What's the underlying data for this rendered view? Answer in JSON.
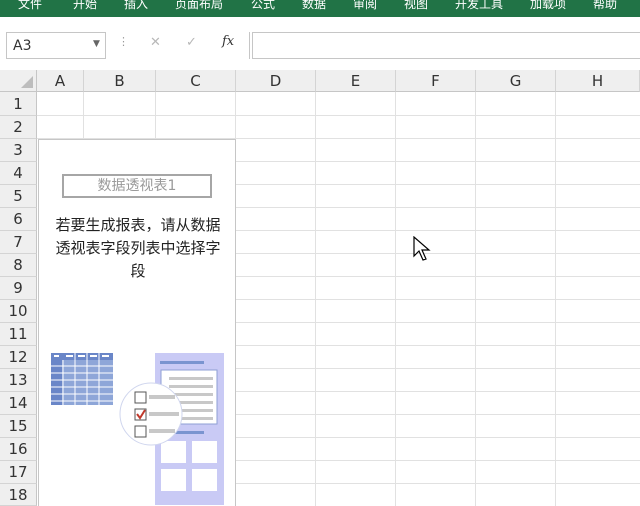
{
  "ribbon": {
    "tabs": [
      "文件",
      "开始",
      "插入",
      "页面布局",
      "公式",
      "数据",
      "审阅",
      "视图",
      "开发工具",
      "加载项",
      "帮助"
    ],
    "color": "#217346"
  },
  "formula_bar": {
    "name_box": "A3",
    "cancel_icon": "✕",
    "enter_icon": "✓",
    "fx_label": "fx",
    "formula_value": ""
  },
  "grid": {
    "columns": [
      "A",
      "B",
      "C",
      "D",
      "E",
      "F",
      "G",
      "H"
    ],
    "rows": [
      "1",
      "2",
      "3",
      "4",
      "5",
      "6",
      "7",
      "8",
      "9",
      "10",
      "11",
      "12",
      "13",
      "14",
      "15",
      "16",
      "17",
      "18"
    ]
  },
  "pivot": {
    "name": "数据透视表1",
    "instruction_lines": [
      "若要生成报表，请从数据",
      "透视表字段列表中选择字",
      "段"
    ],
    "illustration_colors": {
      "blue": "#7a94d0",
      "lavender": "#c9caf5",
      "gray": "#c8c8c8",
      "check": "#c0392b"
    }
  }
}
